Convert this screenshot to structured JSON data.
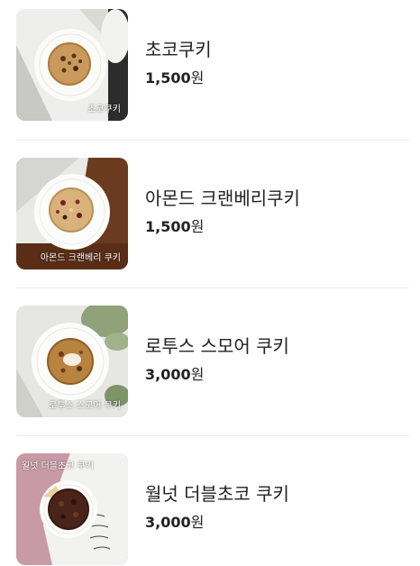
{
  "currency_suffix": "원",
  "menu": {
    "items": [
      {
        "name": "초코쿠키",
        "price": "1,500",
        "image_caption": "초코쿠키"
      },
      {
        "name": "아몬드 크랜베리쿠키",
        "price": "1,500",
        "image_caption": "아몬드 크랜베리 쿠키"
      },
      {
        "name": "로투스 스모어 쿠키",
        "price": "3,000",
        "image_caption": "로투스 스모어 쿠키"
      },
      {
        "name": "월넛 더블초코 쿠키",
        "price": "3,000",
        "image_caption": "월넛 더블초코 쿠키"
      }
    ]
  },
  "colors": {
    "text": "#222222",
    "divider": "#eeeeee",
    "background": "#ffffff"
  }
}
